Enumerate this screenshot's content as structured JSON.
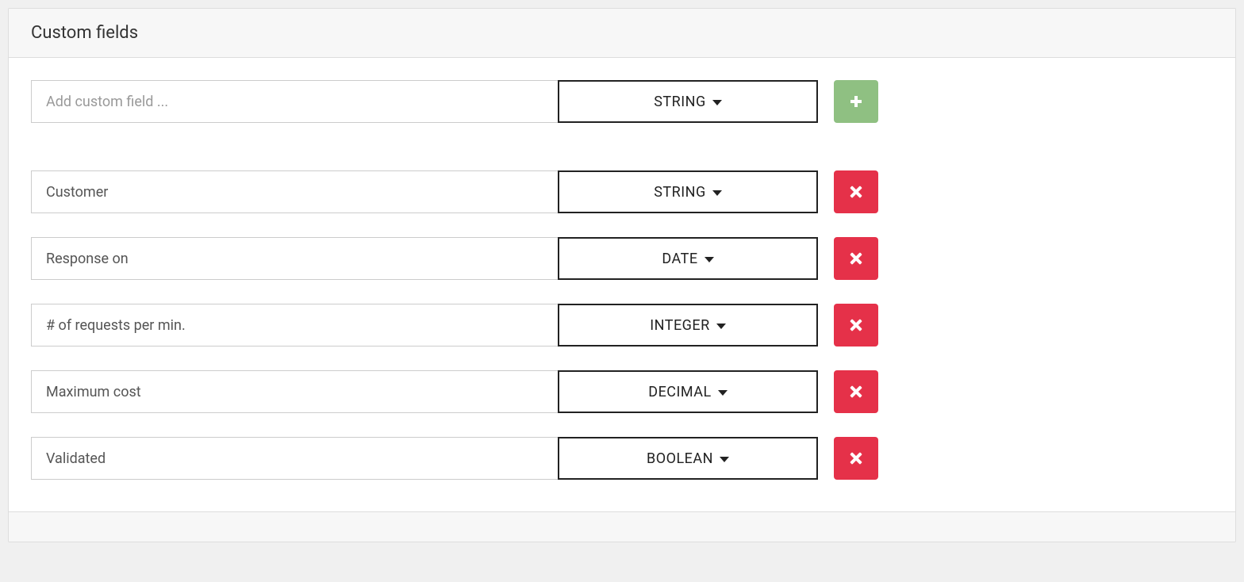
{
  "panel": {
    "title": "Custom fields"
  },
  "addRow": {
    "placeholder": "Add custom field ...",
    "type": "STRING"
  },
  "fields": [
    {
      "name": "Customer",
      "type": "STRING"
    },
    {
      "name": "Response on",
      "type": "DATE"
    },
    {
      "name": "# of requests per min.",
      "type": "INTEGER"
    },
    {
      "name": "Maximum cost",
      "type": "DECIMAL"
    },
    {
      "name": "Validated",
      "type": "BOOLEAN"
    }
  ]
}
